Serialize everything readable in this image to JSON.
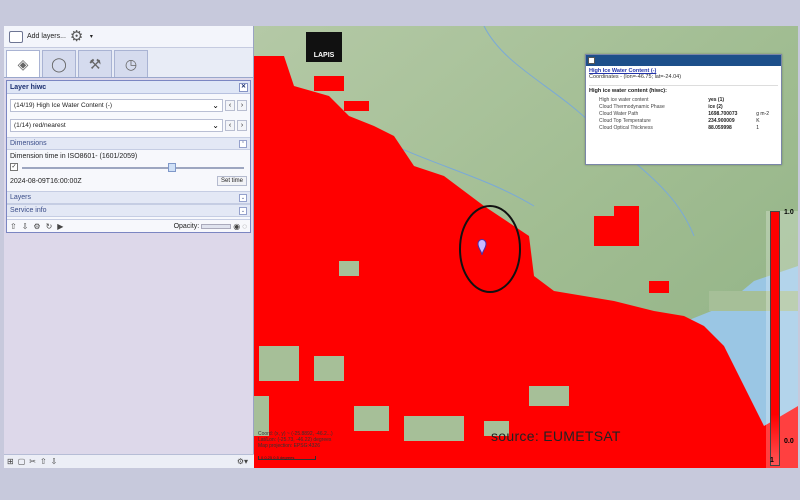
{
  "toolbar": {
    "add_layers_label": "Add layers..."
  },
  "tabs": [
    {
      "name": "layers-tab-icon",
      "glyph": "◈"
    },
    {
      "name": "globe-tab-icon",
      "glyph": "◯"
    },
    {
      "name": "tools-tab-icon",
      "glyph": "⚒"
    },
    {
      "name": "clock-tab-icon",
      "glyph": "◷"
    }
  ],
  "layer_panel": {
    "title": "Layer hiwc",
    "style_select": "(14/19) High Ice Water Content (-)",
    "palette_select": "(1/14) red/nearest",
    "dimensions_label": "Dimensions",
    "dimension_text": "Dimension time in ISO8601- (1601/2059)",
    "time_value": "2024-08-09T16:00:00Z",
    "set_time_label": "Set time",
    "layers_label": "Layers",
    "service_info_label": "Service info",
    "opacity_label": "Opacity:",
    "slider_position": 0.68
  },
  "map": {
    "logo_text": "LAPIS",
    "source_text": "source: EUMETSAT",
    "coords_lines": [
      "Coord: (x, y) ~ (-25.8892, -46.2...)",
      "Lat/Lon: (-25.73, -46.22) degrees",
      "Map projection: EPSG:4326"
    ],
    "scale_label": "0     0.25     0.5 degrees"
  },
  "popup": {
    "title": "High Ice Water Content (-)",
    "coordinates": "Coordinates - (lon=-46.75; lat=-24.04)",
    "header": "High ice water content (hiwc):",
    "rows": [
      {
        "key": "High ice water content",
        "value": "yes (1)",
        "unit": ""
      },
      {
        "key": "Cloud Thermodynamic Phase",
        "value": "ice (2)",
        "unit": ""
      },
      {
        "key": "Cloud Water Path",
        "value": "1698.700073",
        "unit": "g m-2"
      },
      {
        "key": "Cloud Top Temperature",
        "value": "234.900009",
        "unit": "K"
      },
      {
        "key": "Cloud Optical Thickness",
        "value": "88.059998",
        "unit": "1"
      }
    ]
  },
  "legend": {
    "max_label": "1.0",
    "min_label": "0.0",
    "bottom_label": "1"
  },
  "colors": {
    "overlay_red": "#ff0000",
    "terrain": "#9fbf93",
    "water": "#9ac6e4",
    "panel_header": "#1d4f8a"
  }
}
